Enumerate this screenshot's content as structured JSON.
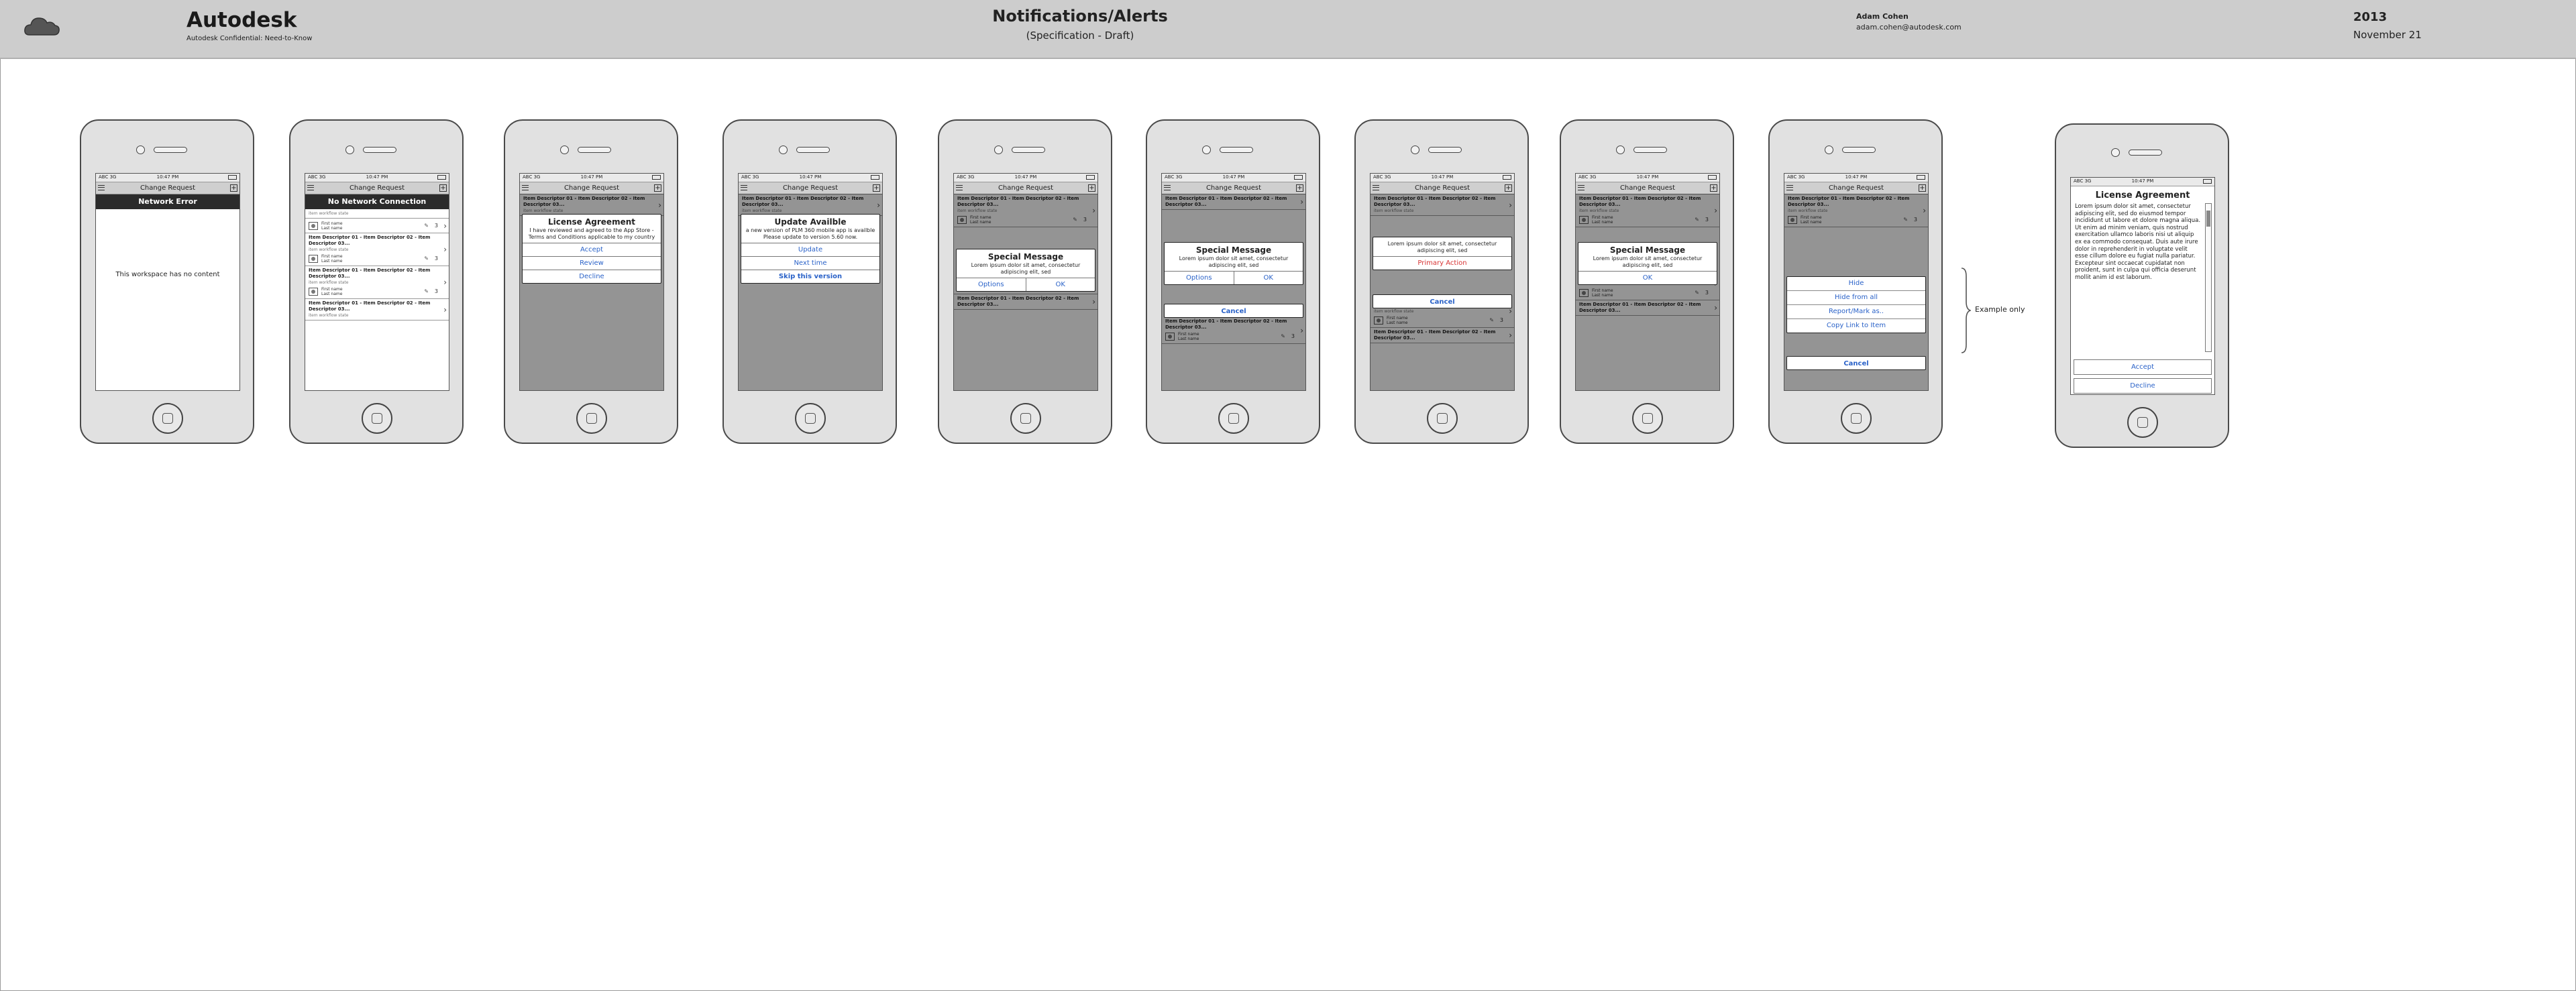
{
  "header": {
    "brand": "Autodesk",
    "brand_sub": "Autodesk Confidential: Need-to-Know",
    "title": "Notifications/Alerts",
    "subtitle": "(Specification - Draft)",
    "author": "Adam Cohen",
    "email": "adam.cohen@autodesk.com",
    "year": "2013",
    "date": "November 21"
  },
  "phone": {
    "carrier": "ABC 3G",
    "time": "10:47 PM",
    "nav_title": "Change Request"
  },
  "list_item": {
    "title": "Item Descriptor 01 - Item Descriptor 02 - Item Descriptor 03...",
    "status": "item workflow state",
    "first_name": "First name",
    "last_name": "Last name",
    "count": "3"
  },
  "screens": {
    "s1": {
      "banner": "Network Error",
      "empty": "This workspace has no content"
    },
    "s2": {
      "banner": "No Network Connection"
    },
    "s3": {
      "title": "License Agreement",
      "body": "I have reviewed and agreed to the App Store - Terms and Conditions applicable to my country",
      "accept": "Accept",
      "review": "Review",
      "decline": "Decline"
    },
    "s4": {
      "title": "Update Availble",
      "body": "a new version of PLM 360 mobile app is availble Please update to version 5.60 now.",
      "update": "Update",
      "next": "Next time",
      "skip": "Skip this version"
    },
    "s5": {
      "title": "Special Message",
      "body": "Lorem ipsum dolor sit amet, consectetur adipiscing elit, sed",
      "options": "Options",
      "ok": "OK"
    },
    "s6": {
      "title": "Special Message",
      "body": "Lorem ipsum dolor sit amet, consectetur adipiscing elit, sed",
      "options": "Options",
      "ok": "OK",
      "cancel": "Cancel"
    },
    "s7": {
      "body": "Lorem ipsum dolor sit amet, consectetur adipiscing elit, sed",
      "primary": "Primary Action",
      "cancel": "Cancel"
    },
    "s8": {
      "title": "Special Message",
      "body": "Lorem ipsum dolor sit amet, consectetur adipiscing elit, sed",
      "ok": "OK"
    },
    "s9": {
      "hide": "Hide",
      "hide_all": "Hide from all",
      "report": "Report/Mark as..",
      "copy": "Copy Link to Item",
      "cancel": "Cancel"
    },
    "s10": {
      "title": "License Agreement",
      "body": "Lorem ipsum dolor sit amet, consectetur adipiscing elit, sed do eiusmod tempor incididunt ut labore et dolore magna aliqua. Ut enim ad minim veniam, quis nostrud exercitation ullamco laboris nisi ut aliquip ex ea commodo consequat. Duis aute irure dolor in reprehenderit in voluptate velit esse cillum dolore eu fugiat nulla pariatur. Excepteur sint occaecat cupidatat non proident, sunt in culpa qui officia deserunt mollit anim id est laborum.",
      "accept": "Accept",
      "decline": "Decline"
    }
  },
  "example_note": "Example only"
}
